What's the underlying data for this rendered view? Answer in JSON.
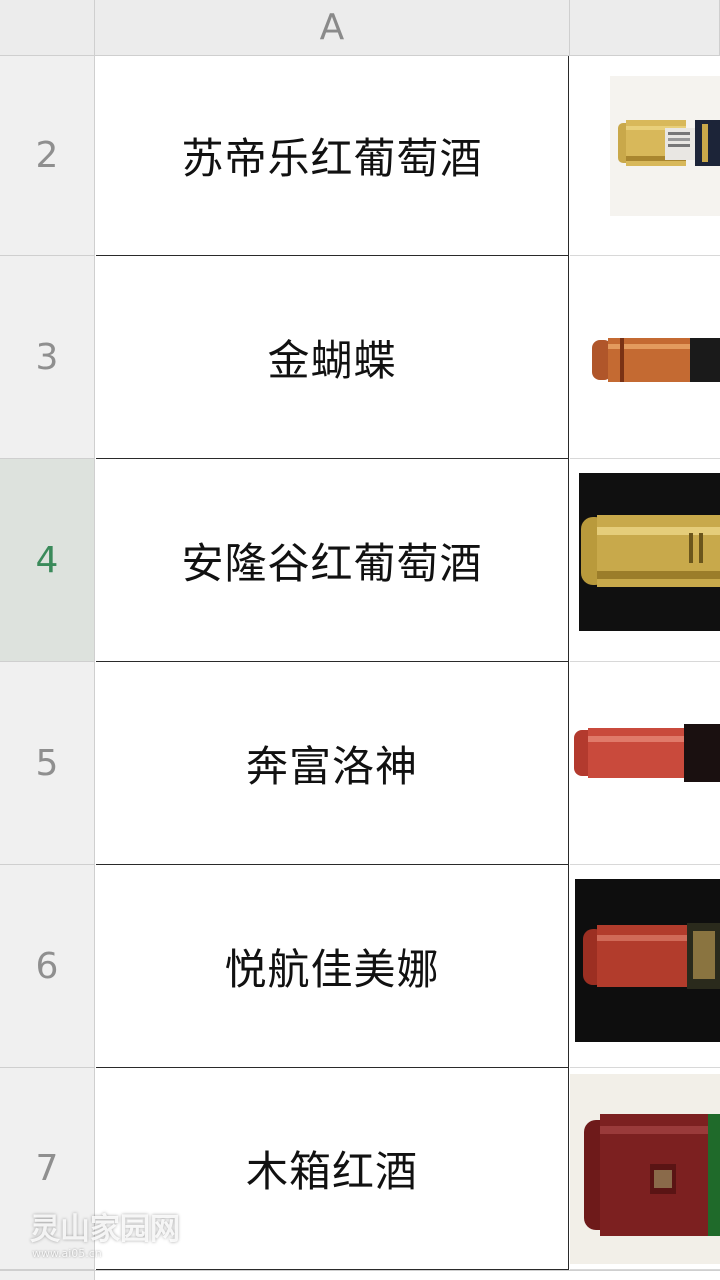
{
  "spreadsheet": {
    "columns": [
      {
        "label": "A"
      },
      {
        "label": ""
      }
    ],
    "rows": [
      {
        "number": "2",
        "name": "苏帝乐红葡萄酒",
        "selected": false,
        "capsule": "gold-white"
      },
      {
        "number": "3",
        "name": "金蝴蝶",
        "selected": false,
        "capsule": "copper"
      },
      {
        "number": "4",
        "name": "安隆谷红葡萄酒",
        "selected": true,
        "capsule": "gold-dark"
      },
      {
        "number": "5",
        "name": "奔富洛神",
        "selected": false,
        "capsule": "red"
      },
      {
        "number": "6",
        "name": "悦航佳美娜",
        "selected": false,
        "capsule": "dark-red"
      },
      {
        "number": "7",
        "name": "木箱红酒",
        "selected": false,
        "capsule": "maroon"
      }
    ]
  },
  "watermark": {
    "main": "灵山家园网",
    "sub": "www.ai05.cn"
  },
  "colors": {
    "accent": "#2e8b57",
    "selected_row_text": "#3a8a5a",
    "header_bg": "#ececec"
  }
}
